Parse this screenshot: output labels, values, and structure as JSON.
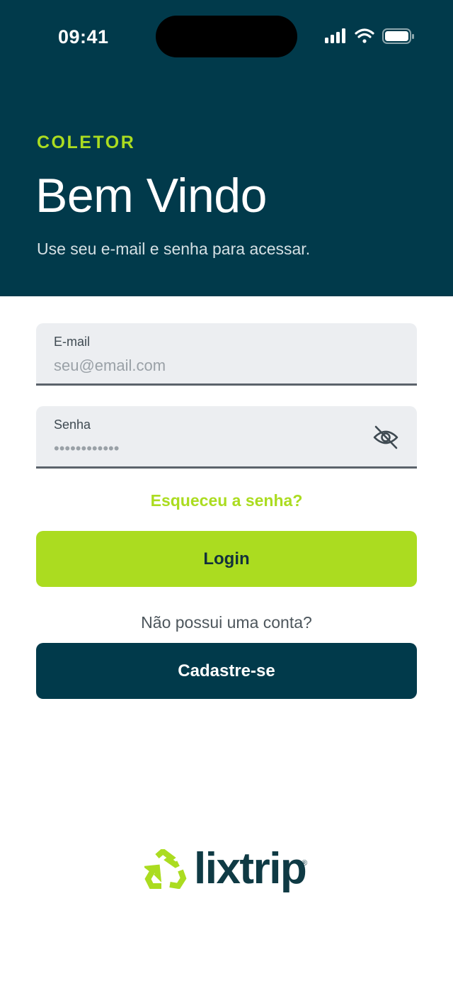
{
  "status_bar": {
    "time": "09:41"
  },
  "header": {
    "eyebrow": "COLETOR",
    "title": "Bem Vindo",
    "subtitle": "Use seu e-mail e senha para acessar."
  },
  "form": {
    "email": {
      "label": "E-mail",
      "placeholder": "seu@email.com",
      "value": ""
    },
    "password": {
      "label": "Senha",
      "value_masked": "••••••••••••",
      "toggle_icon": "eye-off-icon"
    },
    "forgot_link": "Esqueceu a senha?",
    "login_button": "Login",
    "no_account_text": "Não possui uma conta?",
    "signup_button": "Cadastre-se"
  },
  "brand": {
    "name": "lixtrip",
    "registered_mark": "®"
  },
  "colors": {
    "header_bg": "#013a4b",
    "accent_green": "#abdc20",
    "field_bg": "#eceef1",
    "field_border": "#5b636b",
    "dark_text": "#13313b"
  }
}
